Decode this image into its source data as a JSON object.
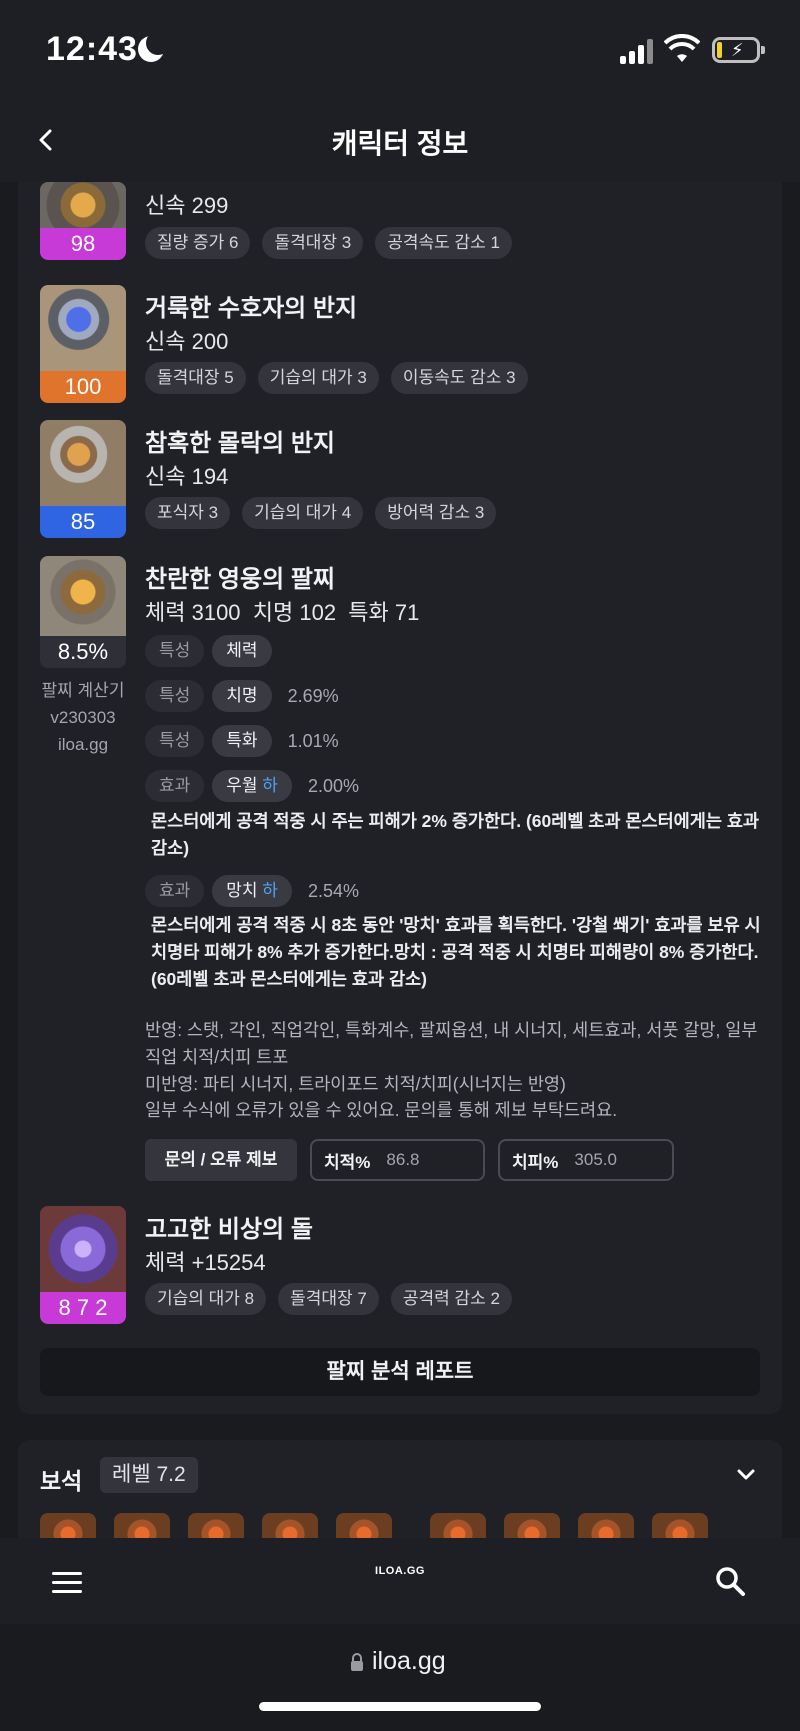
{
  "status": {
    "time": "12:43"
  },
  "header": {
    "title": "캐릭터 정보"
  },
  "items": [
    {
      "name": "",
      "sub": "신속 299",
      "level": "98",
      "tags": [
        "질량 증가 6",
        "돌격대장 3",
        "공격속도 감소 1"
      ]
    },
    {
      "name": "거룩한 수호자의 반지",
      "sub": "신속 200",
      "level": "100",
      "tags": [
        "돌격대장 5",
        "기습의 대가 3",
        "이동속도 감소 3"
      ]
    },
    {
      "name": "참혹한 몰락의 반지",
      "sub": "신속 194",
      "level": "85",
      "tags": [
        "포식자 3",
        "기습의 대가 4",
        "방어력 감소 3"
      ]
    }
  ],
  "bracelet": {
    "name": "찬란한 영웅의 팔찌",
    "stats_line": "체력 3100  치명 102  특화 71",
    "percent": "8.5%",
    "calc_lines": [
      "팔찌 계산기",
      "v230303",
      "iloa.gg"
    ],
    "rows": [
      {
        "label": "특성",
        "value": "체력",
        "low": "",
        "pct": ""
      },
      {
        "label": "특성",
        "value": "치명",
        "low": "",
        "pct": "2.69%"
      },
      {
        "label": "특성",
        "value": "특화",
        "low": "",
        "pct": "1.01%"
      },
      {
        "label": "효과",
        "value": "우월 ",
        "low": "하",
        "pct": "2.00%"
      },
      {
        "label": "효과",
        "value": "망치 ",
        "low": "하",
        "pct": "2.54%"
      }
    ],
    "effect_desc_1": "몬스터에게 공격 적중 시 주는 피해가 2% 증가한다. (60레벨 초과 몬스터에게는 효과 감소)",
    "effect_desc_2": "몬스터에게 공격 적중 시 8초 동안 '망치' 효과를 획득한다. '강철 쐐기' 효과를 보유 시 치명타 피해가 8% 추가 증가한다.망치 : 공격 적중 시 치명타 피해량이 8% 증가한다. (60레벨 초과 몬스터에게는 효과 감소)",
    "note_1": "반영: 스탯, 각인, 직업각인, 특화계수, 팔찌옵션, 내 시너지, 세트효과, 서풋 갈망, 일부 직업 치적/치피 트포",
    "note_2": "미반영: 파티 시너지, 트라이포드 치적/치피(시너지는 반영)",
    "note_3": "일부 수식에 오류가 있을 수 있어요. 문의를 통해 제보 부탁드려요.",
    "report_button": "문의 / 오류 제보",
    "crit_rate_label": "치적%",
    "crit_rate_value": "86.8",
    "crit_dmg_label": "치피%",
    "crit_dmg_value": "305.0"
  },
  "stone": {
    "name": "고고한 비상의 돌",
    "sub": "체력 +15254",
    "level": "8 7 2",
    "tags": [
      "기습의 대가 8",
      "돌격대장 7",
      "공격력 감소 2"
    ]
  },
  "analysis_button": "팔찌 분석 레포트",
  "gems": {
    "title": "보석",
    "level": "레벨 7.2"
  },
  "nav": {
    "logo": "ILOA.GG"
  },
  "url": "iloa.gg"
}
